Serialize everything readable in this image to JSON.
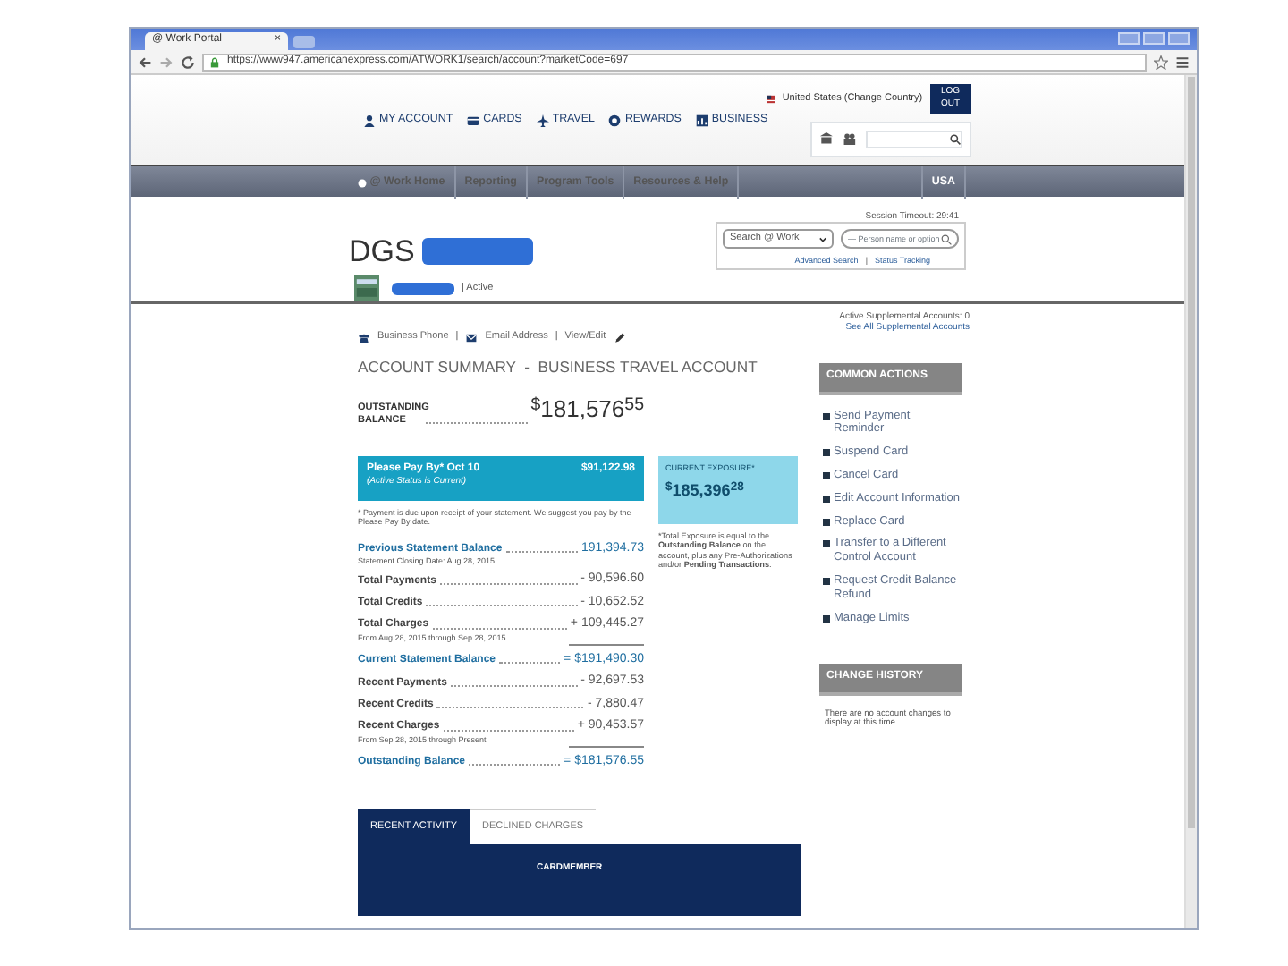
{
  "browser": {
    "tab_title": "@ Work Portal",
    "tab_close": "×",
    "url": "https://www947.americanexpress.com/ATWORK1/search/account?marketCode=697"
  },
  "header": {
    "nav": [
      {
        "label": "MY ACCOUNT",
        "kind": "person"
      },
      {
        "label": "CARDS",
        "kind": "card"
      },
      {
        "label": "TRAVEL",
        "kind": "plane"
      },
      {
        "label": "REWARDS",
        "kind": "badge"
      },
      {
        "label": "BUSINESS",
        "kind": "chart"
      }
    ],
    "country": "United States (Change Country)",
    "logout": "LOG OUT"
  },
  "main_nav": [
    "@ Work Home",
    "Reporting",
    "Program Tools",
    "Resources & Help"
  ],
  "region": "USA",
  "session": "Session Timeout: 29:41",
  "account": {
    "title": "DGS",
    "status": "| Active"
  },
  "search": {
    "select": "Search @ Work",
    "placeholder": "— Person name or option",
    "links": [
      "Advanced Search",
      "Status Tracking"
    ],
    "separator": "|"
  },
  "contact_separator": "|",
  "contacts": [
    {
      "label": "Business Phone",
      "kind": "phone"
    },
    {
      "label": "Email Address",
      "kind": "mail"
    },
    {
      "label": "View/Edit",
      "kind": "pencil"
    }
  ],
  "supplemental": {
    "count": "Active Supplemental Accounts: 0",
    "link": "See All Supplemental Accounts"
  },
  "summary_title": "ACCOUNT SUMMARY  -  BUSINESS TRAVEL ACCOUNT",
  "outstanding": {
    "label": "OUTSTANDING BALANCE",
    "amount": "$^{$}$181,576$^{55}$"
  },
  "pay_box": {
    "title": "Please Pay By* Oct 10",
    "subtitle": "(Active Status is Current)",
    "amount": "$91,122.98",
    "note": "* Payment is due upon receipt of your statement. We suggest you pay by the Please Pay By date."
  },
  "exposure": {
    "title": "CURRENT EXPOSURE*",
    "amount": "$^{$}$185,396$^{28}$",
    "note": "*Total Exposure is equal to the **Outstanding Balance** on the account, plus any Pre-Authorizations and/or **Pending Transactions**."
  },
  "lines": [
    {
      "kind": "total",
      "label": "Previous Statement Balance",
      "amount": "191,394.73",
      "note": "Statement Closing Date: Aug 28, 2015"
    },
    {
      "kind": "line",
      "label": "Total Payments",
      "amount": "- 90,596.60"
    },
    {
      "kind": "line",
      "label": "Total Credits",
      "amount": "- 10,652.52"
    },
    {
      "kind": "line",
      "label": "Total Charges",
      "amount": "+ 109,445.27",
      "note": "From Aug 28, 2015 through Sep 28, 2015"
    },
    {
      "kind": "rule"
    },
    {
      "kind": "total",
      "label": "Current Statement Balance",
      "amount": "= $191,490.30"
    },
    {
      "kind": "line",
      "label": "Recent Payments",
      "amount": "- 92,697.53"
    },
    {
      "kind": "line",
      "label": "Recent Credits",
      "amount": "- 7,880.47"
    },
    {
      "kind": "line",
      "label": "Recent Charges",
      "amount": "+ 90,453.57",
      "note": "From Sep 28, 2015 through Present"
    },
    {
      "kind": "rule"
    },
    {
      "kind": "total",
      "label": "Outstanding Balance",
      "amount": "= $181,576.55"
    }
  ],
  "activity_tabs": [
    {
      "label": "RECENT ACTIVITY",
      "selected": true
    },
    {
      "label": "DECLINED CHARGES",
      "selected": false
    }
  ],
  "activity_table": {
    "columns": [
      "CARDMEMBER"
    ]
  },
  "common_actions": {
    "title": "COMMON ACTIONS",
    "items": [
      "Send Payment Reminder",
      "Suspend Card",
      "Cancel Card",
      "Edit Account Information",
      "Replace Card",
      "Transfer to a Different Control Account",
      "Request Credit Balance Refund",
      "Manage Limits"
    ]
  },
  "change_history": {
    "title": "CHANGE HISTORY",
    "text": "There are no account changes to display at this time."
  }
}
